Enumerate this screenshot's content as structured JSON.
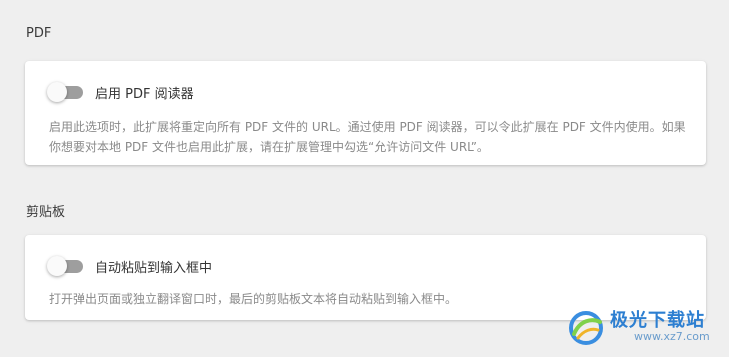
{
  "sections": [
    {
      "title": "PDF",
      "toggle_label": "启用 PDF 阅读器",
      "toggle_on": false,
      "description": "启用此选项时，此扩展将重定向所有 PDF 文件的 URL。通过使用 PDF 阅读器，可以令此扩展在 PDF 文件内使用。如果你想要对本地 PDF 文件也启用此扩展，请在扩展管理中勾选“允许访问文件 URL”。"
    },
    {
      "title": "剪贴板",
      "toggle_label": "自动粘贴到输入框中",
      "toggle_on": false,
      "description": "打开弹出页面或独立翻译窗口时，最后的剪贴板文本将自动粘贴到输入框中。"
    }
  ],
  "watermark": {
    "brand": "极光下载站",
    "url": "www.xz7.com"
  },
  "colors": {
    "background": "#efefef",
    "card": "#ffffff",
    "toggle_off_track": "#9e9e9e",
    "description_text": "#8a8a8a",
    "watermark_brand": "#2d7fd1"
  }
}
